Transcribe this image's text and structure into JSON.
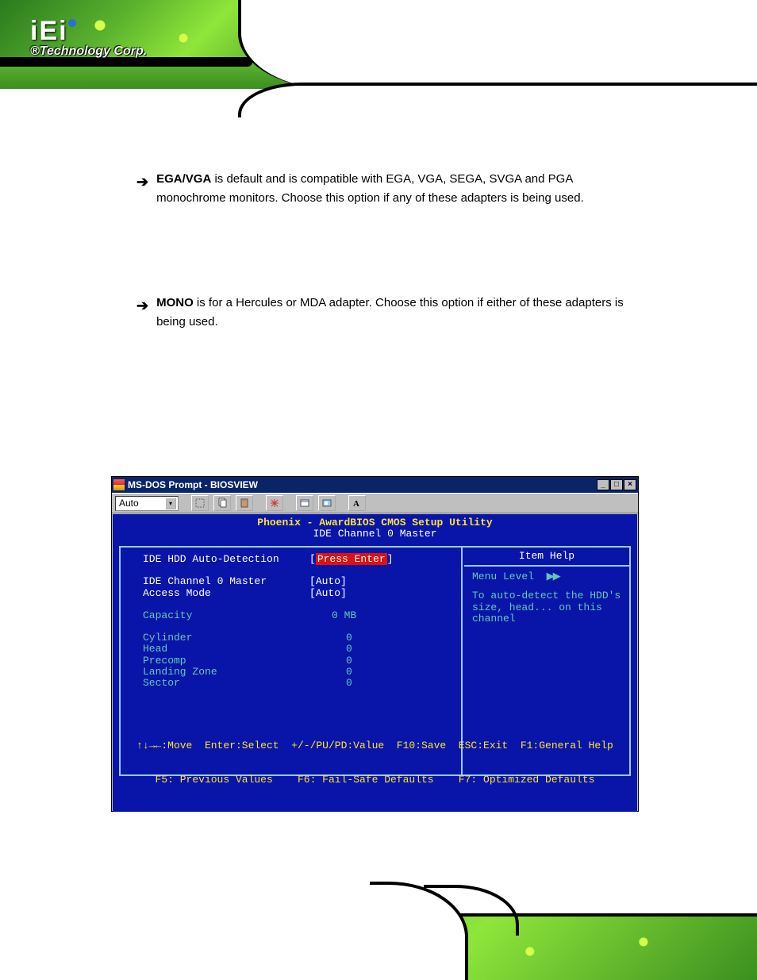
{
  "logo": {
    "brand": "iEi",
    "subline": "®Technology Corp."
  },
  "paragraphs": {
    "p1_bold": "EGA/VGA",
    "p1_text": " is default and is compatible with EGA, VGA, SEGA, SVGA and PGA monochrome monitors. Choose this option if any of these adapters is being used.",
    "p2_bold": "MONO",
    "p2_text": " is for a Hercules or MDA adapter. Choose this option if either of these adapters is being used."
  },
  "bios_window": {
    "title": "MS-DOS Prompt - BIOSVIEW",
    "combo_value": "Auto",
    "header1": "Phoenix - AwardBIOS CMOS Setup Utility",
    "header2": "IDE Channel 0 Master",
    "left_rows": {
      "auto_detect_label": "IDE HDD Auto-Detection",
      "auto_detect_value": "Press Enter",
      "ch0_label": "IDE Channel 0 Master",
      "ch0_value": "Auto",
      "access_label": "Access Mode",
      "access_value": "Auto",
      "capacity_label": "Capacity",
      "capacity_value": "0 MB",
      "cyl_label": "Cylinder",
      "cyl_value": "0",
      "head_label": "Head",
      "head_value": "0",
      "precomp_label": "Precomp",
      "precomp_value": "0",
      "lz_label": "Landing Zone",
      "lz_value": "0",
      "sector_label": "Sector",
      "sector_value": "0"
    },
    "right": {
      "title": "Item Help",
      "menu_level": "Menu Level",
      "help_text": "To auto-detect the HDD's size, head... on this channel"
    },
    "footer1": "↑↓→←:Move  Enter:Select  +/-/PU/PD:Value  F10:Save  ESC:Exit  F1:General Help",
    "footer2": "F5: Previous Values    F6: Fail-Safe Defaults    F7: Optimized Defaults"
  }
}
